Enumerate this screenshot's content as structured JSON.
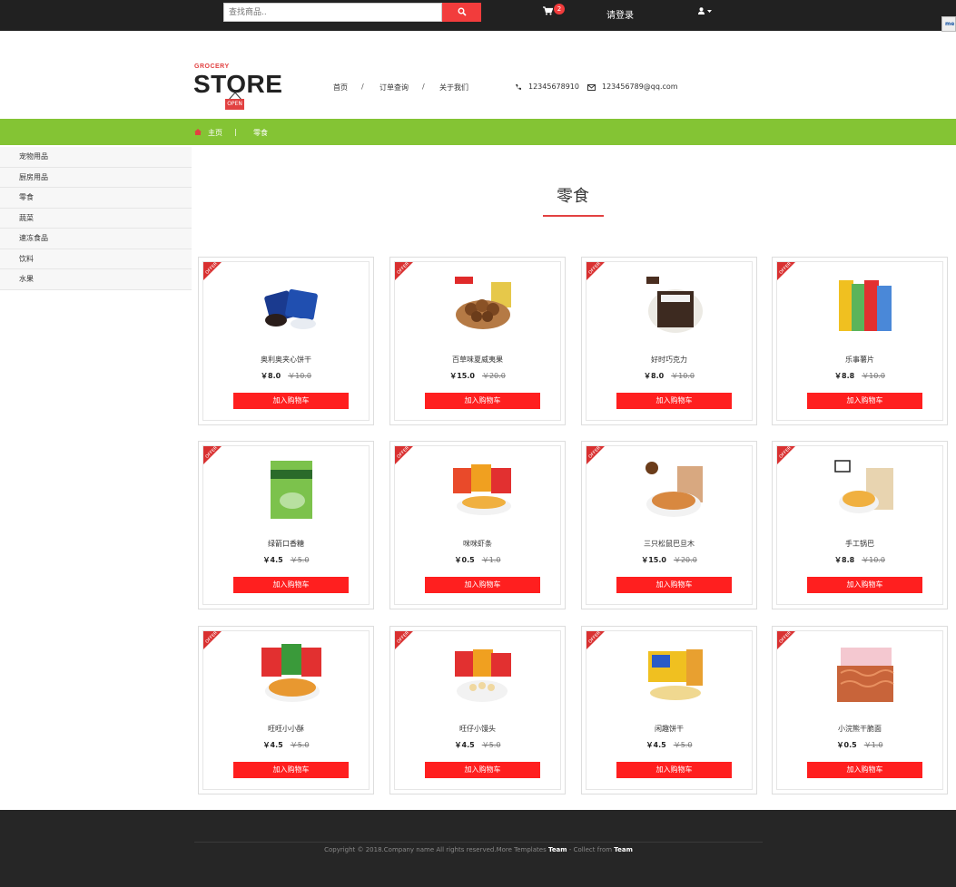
{
  "topbar": {
    "search_placeholder": "查找商品..",
    "cart_count": "2",
    "login_label": "请登录",
    "side_tab": "me"
  },
  "logo": {
    "small": "GROCERY",
    "big": "STORE",
    "open": "OPEN"
  },
  "nav": {
    "home": "首页",
    "orders": "订单查询",
    "about": "关于我们",
    "sep": "/"
  },
  "contact": {
    "phone": "12345678910",
    "email": "123456789@qq.com"
  },
  "breadcrumb": {
    "home": "主页",
    "sep": "|",
    "current": "零食"
  },
  "categories": [
    "宠物用品",
    "厨房用品",
    "零食",
    "蔬菜",
    "速冻食品",
    "饮料",
    "水果"
  ],
  "page_title": "零食",
  "offer_label": "OFFER",
  "add_to_cart": "加入购物车",
  "products": [
    {
      "name": "奥利奥夹心饼干",
      "price": "￥8.0",
      "old": "￥10.0"
    },
    {
      "name": "百草味夏威夷果",
      "price": "￥15.0",
      "old": "￥20.0"
    },
    {
      "name": "好时巧克力",
      "price": "￥8.0",
      "old": "￥10.0"
    },
    {
      "name": "乐事薯片",
      "price": "￥8.8",
      "old": "￥10.0"
    },
    {
      "name": "绿箭口香糖",
      "price": "￥4.5",
      "old": "￥5.0"
    },
    {
      "name": "咪咪虾条",
      "price": "￥0.5",
      "old": "￥1.0"
    },
    {
      "name": "三只松鼠巴旦木",
      "price": "￥15.0",
      "old": "￥20.0"
    },
    {
      "name": "手工锅巴",
      "price": "￥8.8",
      "old": "￥10.0"
    },
    {
      "name": "旺旺小小酥",
      "price": "￥4.5",
      "old": "￥5.0"
    },
    {
      "name": "旺仔小馒头",
      "price": "￥4.5",
      "old": "￥5.0"
    },
    {
      "name": "闲趣饼干",
      "price": "￥4.5",
      "old": "￥5.0"
    },
    {
      "name": "小浣熊干脆面",
      "price": "￥0.5",
      "old": "￥1.0"
    }
  ],
  "footer": {
    "copyright_prefix": "Copyright © 2018.Company name All rights reserved.More Templates ",
    "team1": "Team",
    "mid": " - Collect from ",
    "team2": "Team"
  }
}
